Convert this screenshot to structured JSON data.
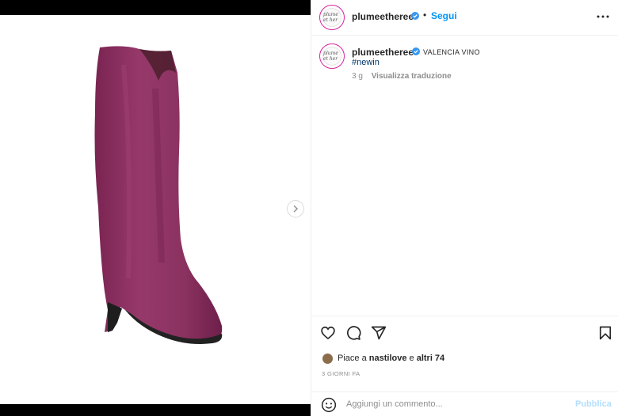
{
  "post": {
    "author": {
      "username": "plumeetheree",
      "verified_icon": "verified-badge-icon",
      "avatar_text": "plume et her",
      "follow_label": "Segui",
      "separator": "•"
    },
    "more_icon": "more-options-icon",
    "caption": {
      "username": "plumeetheree",
      "text": "VALENCIA VINO",
      "hashtag": "#newin",
      "time": "3 g",
      "translate_label": "Visualizza traduzione"
    },
    "media": {
      "subject": "boot-image",
      "next_icon": "chevron-right-icon"
    },
    "actions": {
      "like_icon": "heart-icon",
      "comment_icon": "comment-icon",
      "share_icon": "paper-plane-icon",
      "save_icon": "bookmark-icon"
    },
    "likes": {
      "prefix": "Piace a",
      "user": "nastilove",
      "conj": "e",
      "others": "altri 74"
    },
    "date": "3 GIORNI FA",
    "comment": {
      "emoji_icon": "emoji-icon",
      "placeholder": "Aggiungi un commento...",
      "publish_label": "Pubblica"
    },
    "colors": {
      "link_blue": "#0095f6",
      "hashtag_blue": "#00376b",
      "publish_disabled": "#b2dffc",
      "boot": "#8e2f5f"
    }
  }
}
